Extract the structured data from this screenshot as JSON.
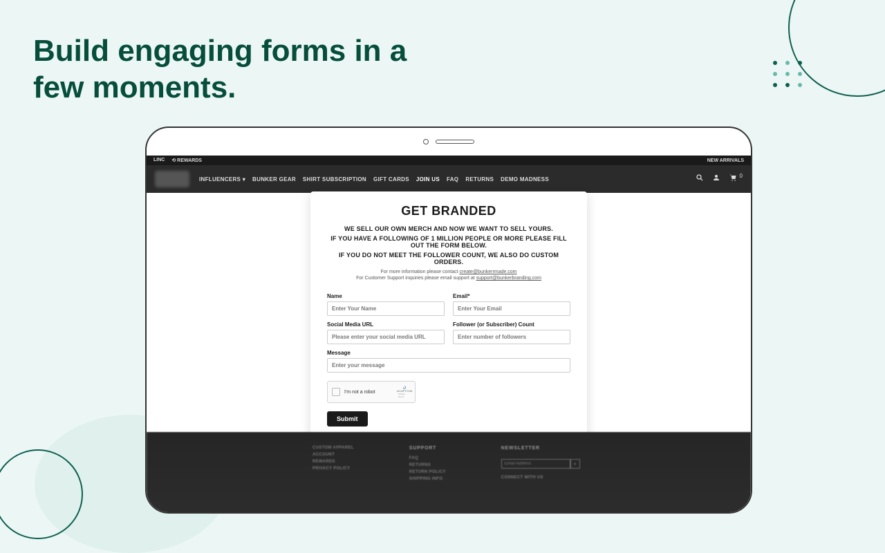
{
  "hero": {
    "headline": "Build engaging forms in a few moments."
  },
  "topbar": {
    "brand": "LINC",
    "rewards": "⟲ REWARDS",
    "announce": "NEW ARRIVALS"
  },
  "nav": {
    "items": [
      "INFLUENCERS",
      "BUNKER GEAR",
      "SHIRT SUBSCRIPTION",
      "GIFT CARDS",
      "JOIN US",
      "FAQ",
      "RETURNS",
      "DEMO MADNESS"
    ],
    "cart_count": "0"
  },
  "form": {
    "title": "GET BRANDED",
    "sub1": "WE SELL OUR OWN MERCH AND NOW WE WANT TO SELL YOURS.",
    "sub2": "IF YOU HAVE A FOLLOWING OF 1 MILLION PEOPLE OR MORE PLEASE FILL OUT THE FORM BELOW.",
    "sub3": "IF YOU DO NOT MEET THE FOLLOWER COUNT, WE ALSO DO CUSTOM ORDERS.",
    "info1_pre": "For more information please contact ",
    "info1_link": "create@bunkerrmade.com",
    "info2_pre": "For Customer Support inquiries please email support at ",
    "info2_link": "support@bunkerbranding.com",
    "fields": {
      "name_label": "Name",
      "name_ph": "Enter Your Name",
      "email_label": "Email*",
      "email_ph": "Enter Your Email",
      "social_label": "Social Media URL",
      "social_ph": "Please enter your social media URL",
      "followers_label": "Follower (or Subscriber) Count",
      "followers_ph": "Enter number of followers",
      "message_label": "Message",
      "message_ph": "Enter your message"
    },
    "captcha": {
      "label": "I'm not a robot",
      "brand": "reCAPTCHA",
      "meta": "Privacy · Terms"
    },
    "submit": "Submit"
  },
  "footer": {
    "col1": {
      "title": "",
      "items": [
        "CUSTOM APPAREL",
        "ACCOUNT",
        "REWARDS",
        "PRIVACY POLICY"
      ]
    },
    "col2": {
      "title": "SUPPORT",
      "items": [
        "FAQ",
        "RETURNS",
        "RETURN POLICY",
        "SHIPPING INFO"
      ]
    },
    "col3": {
      "title": "NEWSLETTER",
      "connect": "CONNECT WITH US",
      "placeholder": "Email Address"
    }
  }
}
